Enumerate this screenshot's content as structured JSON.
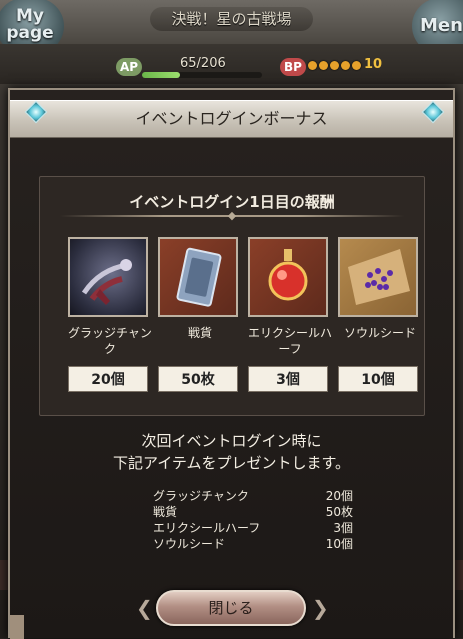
{
  "background": {
    "mypage_label": "My\npage",
    "menu_label": "Men",
    "title": "決戦！星の古戦場",
    "ap_label": "AP",
    "ap_value": "65/206",
    "ap_fraction": 0.32,
    "bp_label": "BP",
    "bp_value": "10"
  },
  "dialog": {
    "title": "イベントログインボーナス",
    "reward_title": "イベントログイン1日目の報酬",
    "items": [
      {
        "name": "グラッジチャンク",
        "qty": "20個",
        "icon": "grudge-chunk-icon"
      },
      {
        "name": "戦貨",
        "qty": "50枚",
        "icon": "war-currency-card-icon"
      },
      {
        "name": "エリクシールハーフ",
        "qty": "3個",
        "icon": "elixir-half-bottle-icon"
      },
      {
        "name": "ソウルシード",
        "qty": "10個",
        "icon": "soul-seed-icon"
      }
    ],
    "next_message_line1": "次回イベントログイン時に",
    "next_message_line2": "下記アイテムをプレゼントします。",
    "next_items": [
      {
        "name": "グラッジチャンク",
        "qty": "20個"
      },
      {
        "name": "戦貨",
        "qty": "50枚"
      },
      {
        "name": "エリクシールハーフ",
        "qty": "3個"
      },
      {
        "name": "ソウルシード",
        "qty": "10個"
      }
    ],
    "close_label": "閉じる"
  }
}
